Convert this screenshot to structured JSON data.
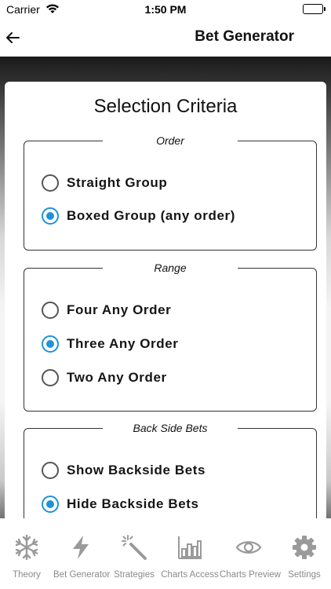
{
  "status_bar": {
    "carrier": "Carrier",
    "time": "1:50 PM"
  },
  "nav": {
    "title": "Bet Generator"
  },
  "card": {
    "title": "Selection Criteria",
    "groups": [
      {
        "legend": "Order",
        "options": [
          {
            "label": "Straight Group",
            "selected": false
          },
          {
            "label": "Boxed Group (any order)",
            "selected": true
          }
        ]
      },
      {
        "legend": "Range",
        "options": [
          {
            "label": "Four Any Order",
            "selected": false
          },
          {
            "label": "Three Any Order",
            "selected": true
          },
          {
            "label": "Two Any Order",
            "selected": false
          }
        ]
      },
      {
        "legend": "Back Side Bets",
        "options": [
          {
            "label": "Show Backside Bets",
            "selected": false
          },
          {
            "label": "Hide Backside Bets",
            "selected": true
          }
        ]
      }
    ]
  },
  "tabs": [
    {
      "label": "Theory",
      "icon": "snowflake-icon"
    },
    {
      "label": "Bet Generator",
      "icon": "lightning-icon"
    },
    {
      "label": "Strategies",
      "icon": "magic-wand-icon"
    },
    {
      "label": "Charts Access",
      "icon": "bar-chart-icon"
    },
    {
      "label": "Charts Preview",
      "icon": "eye-icon"
    },
    {
      "label": "Settings",
      "icon": "gear-icon"
    }
  ],
  "colors": {
    "accent": "#1f93d6",
    "icon_gray": "#9a9a9a"
  }
}
